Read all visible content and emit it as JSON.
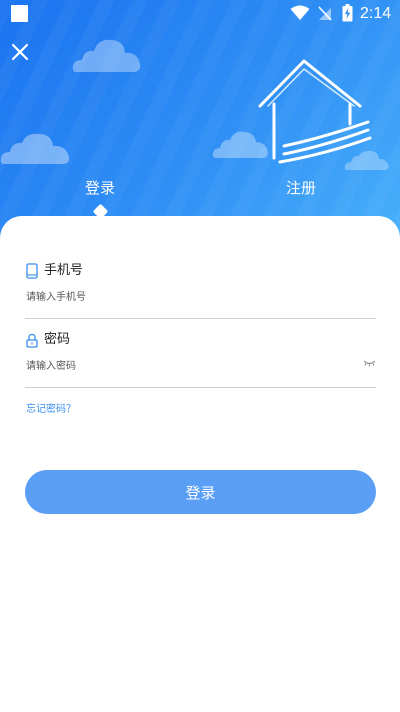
{
  "status_bar": {
    "time": "2:14",
    "icons": [
      "square-notification-icon",
      "wifi-icon",
      "no-signal-icon",
      "battery-charging-icon"
    ]
  },
  "header": {
    "close_icon": "close-icon",
    "tabs": [
      {
        "label": "登录",
        "active": true
      },
      {
        "label": "注册",
        "active": false
      }
    ]
  },
  "form": {
    "phone": {
      "label": "手机号",
      "icon": "phone-icon",
      "placeholder": "请输入手机号",
      "value": ""
    },
    "password": {
      "label": "密码",
      "icon": "lock-icon",
      "placeholder": "请输入密码",
      "value": "",
      "toggle_icon": "eye-closed-icon"
    },
    "forgot_label": "忘记密码？",
    "submit_label": "登录"
  },
  "colors": {
    "gradient_start": "#1a73f0",
    "gradient_end": "#48b0fb",
    "accent": "#3a8ff0",
    "button": "#5b9ef6"
  }
}
